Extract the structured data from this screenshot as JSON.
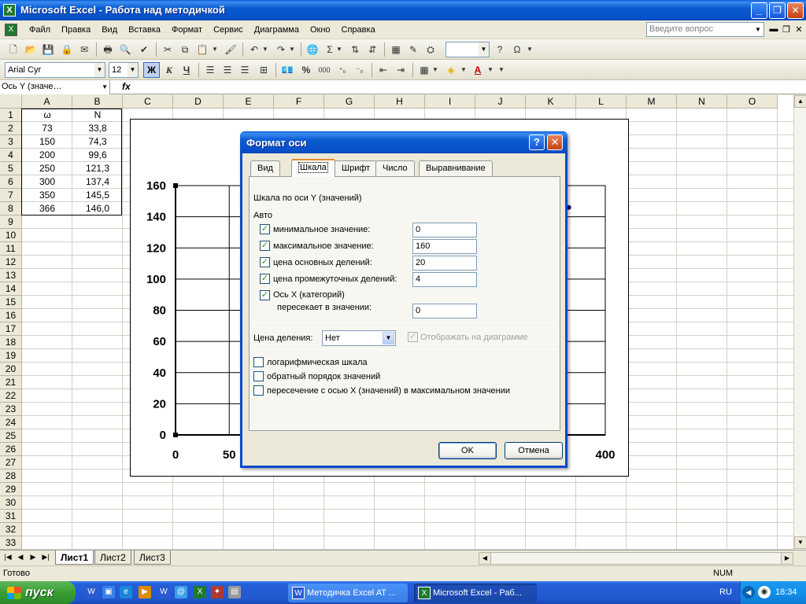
{
  "window": {
    "title": "Microsoft Excel - Работа над методичкой",
    "minimize": "_",
    "restore": "❐",
    "close": "✕"
  },
  "menu": {
    "items": [
      "Файл",
      "Правка",
      "Вид",
      "Вставка",
      "Формат",
      "Сервис",
      "Диаграмма",
      "Окно",
      "Справка"
    ],
    "help_placeholder": "Введите вопрос"
  },
  "toolbar": {
    "font_name": "Arial Cyr",
    "font_size": "12",
    "bold_label": "Ж",
    "italic_label": "К",
    "underline_label": "Ч",
    "percent_label": "%",
    "thousands_label": "000"
  },
  "formula_bar": {
    "name_box": "Ось Y (значе…",
    "fx": "fx"
  },
  "grid": {
    "columns": [
      "A",
      "B",
      "C",
      "D",
      "E",
      "F",
      "G",
      "H",
      "I",
      "J",
      "K",
      "L",
      "M",
      "N",
      "O"
    ],
    "row_count": 33,
    "header_row": {
      "a": "ω",
      "b": "N"
    },
    "rows": [
      {
        "a": "73",
        "b": "33,8"
      },
      {
        "a": "150",
        "b": "74,3"
      },
      {
        "a": "200",
        "b": "99,6"
      },
      {
        "a": "250",
        "b": "121,3"
      },
      {
        "a": "300",
        "b": "137,4"
      },
      {
        "a": "350",
        "b": "145,5"
      },
      {
        "a": "366",
        "b": "146,0"
      }
    ]
  },
  "chart_data": {
    "type": "scatter",
    "x": [
      73,
      150,
      200,
      250,
      300,
      350,
      366
    ],
    "y": [
      33.8,
      74.3,
      99.6,
      121.3,
      137.4,
      145.5,
      146.0
    ],
    "xlim": [
      0,
      400
    ],
    "ylim": [
      0,
      160
    ],
    "yticks": [
      "0",
      "20",
      "40",
      "60",
      "80",
      "100",
      "120",
      "140",
      "160"
    ],
    "xticks": [
      "0",
      "50",
      "400"
    ],
    "grid": true
  },
  "sheets": {
    "tabs": [
      "Лист1",
      "Лист2",
      "Лист3"
    ],
    "active": "Лист1"
  },
  "status": {
    "ready": "Готово",
    "num": "NUM"
  },
  "taskbar": {
    "start": "пуск",
    "tasks": [
      "Методичка Excel AT ...",
      "Microsoft Excel - Раб..."
    ],
    "lang": "RU",
    "clock": "18:34"
  },
  "dialog": {
    "title": "Формат оси",
    "help": "?",
    "close": "✕",
    "tabs": [
      "Вид",
      "Шкала",
      "Шрифт",
      "Число",
      "Выравнивание"
    ],
    "active_tab": "Шкала",
    "section_title": "Шкала по оси Y (значений)",
    "auto_label": "Авто",
    "fields": [
      {
        "label": "минимальное значение:",
        "value": "0",
        "checked": true
      },
      {
        "label": "максимальное значение:",
        "value": "160",
        "checked": true
      },
      {
        "label": "цена основных делений:",
        "value": "20",
        "checked": true
      },
      {
        "label": "цена промежуточных делений:",
        "value": "4",
        "checked": true
      }
    ],
    "x_axis_label": "Ось X (категорий)",
    "crosses_at_label": "пересекает в значении:",
    "crosses_at_value": "0",
    "display_units_label": "Цена деления:",
    "display_units_value": "Нет",
    "show_on_chart_label": "Отображать на диаграмме",
    "options": [
      {
        "label": "логарифмическая шкала",
        "checked": false
      },
      {
        "label": "обратный порядок значений",
        "checked": false
      },
      {
        "label": "пересечение с осью X (значений) в максимальном значении",
        "checked": false
      }
    ],
    "ok": "OK",
    "cancel": "Отмена",
    "check_mark": "✓"
  }
}
